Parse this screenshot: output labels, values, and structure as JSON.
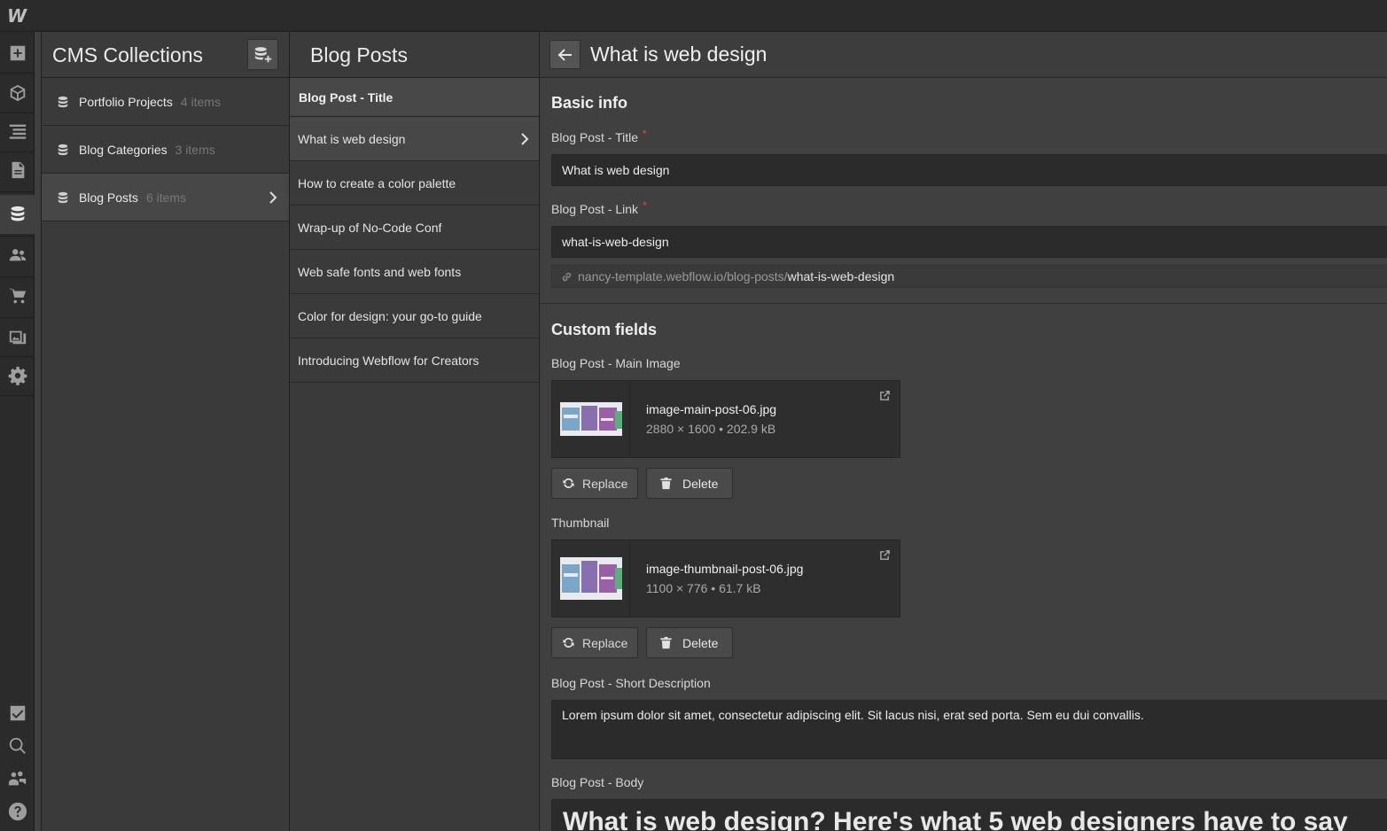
{
  "app": {
    "logo": "W"
  },
  "sidebar_icons": [
    "add-icon",
    "components-icon",
    "navigator-icon",
    "pages-icon",
    "cms-icon",
    "users-icon",
    "ecommerce-icon",
    "assets-icon",
    "settings-icon",
    "audit-icon",
    "search-icon",
    "collaborators-icon",
    "help-icon"
  ],
  "collections": {
    "title": "CMS Collections",
    "items": [
      {
        "name": "Portfolio Projects",
        "count": "4 items"
      },
      {
        "name": "Blog Categories",
        "count": "3 items"
      },
      {
        "name": "Blog Posts",
        "count": "6 items"
      }
    ]
  },
  "posts": {
    "title": "Blog Posts",
    "column_header": "Blog Post - Title",
    "items": [
      "What is web design",
      "How to create a color palette",
      "Wrap-up of No-Code Conf",
      "Web safe fonts and web fonts",
      "Color for design: your go-to guide",
      "Introducing Webflow for Creators"
    ]
  },
  "editor": {
    "title": "What is web design",
    "basic_info": "Basic info",
    "title_label": "Blog Post - Title",
    "title_value": "What is web design",
    "link_label": "Blog Post - Link",
    "link_value": "what-is-web-design",
    "url_base": "nancy-template.webflow.io/blog-posts/",
    "url_slug": "what-is-web-design",
    "required_mark": "*",
    "custom_fields": "Custom fields",
    "main_image_label": "Blog Post - Main Image",
    "main_image": {
      "name": "image-main-post-06.jpg",
      "meta": "2880 × 1600 • 202.9 kB"
    },
    "thumbnail_label": "Thumbnail",
    "thumbnail": {
      "name": "image-thumbnail-post-06.jpg",
      "meta": "1100 × 776 • 61.7 kB"
    },
    "replace_label": "Replace",
    "delete_label": "Delete",
    "short_desc_label": "Blog Post - Short Description",
    "short_desc_value": "Lorem ipsum dolor sit amet, consectetur adipiscing elit. Sit lacus nisi, erat sed porta. Sem eu dui convallis.",
    "body_label": "Blog Post - Body",
    "body_heading": "What is web design? Here's what 5 web designers have to say"
  }
}
